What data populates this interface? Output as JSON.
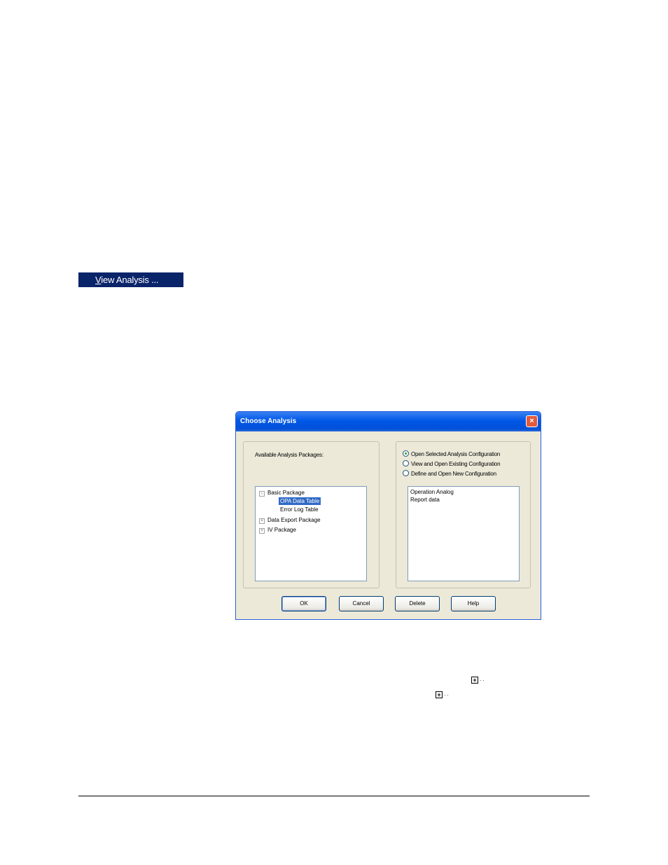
{
  "menu": {
    "label_mnemonic": "V",
    "label_rest": "iew Analysis ..."
  },
  "dialog": {
    "title": "Choose Analysis",
    "close_glyph": "×",
    "packages_label": "Available Analysis Packages:",
    "tree": [
      {
        "label": "Basic Package",
        "expander": "−"
      },
      {
        "label": "OPA Data Table",
        "selected": true
      },
      {
        "label": "Error Log Table"
      },
      {
        "label": "Data Export Package",
        "expander": "+"
      },
      {
        "label": "IV Package",
        "expander": "+"
      }
    ],
    "options": [
      {
        "label": "Open Selected Analysis Configuration",
        "checked": true
      },
      {
        "label": "View and Open Existing Configuration",
        "checked": false
      },
      {
        "label": "Define and Open New Configuration",
        "checked": false
      }
    ],
    "configurations": [
      "Operation Analog",
      "Report data"
    ],
    "buttons": {
      "ok": "OK",
      "cancel": "Cancel",
      "delete": "Delete",
      "help": "Help"
    }
  },
  "inline_icons": {
    "plus_glyph": "+",
    "dots": "··"
  }
}
